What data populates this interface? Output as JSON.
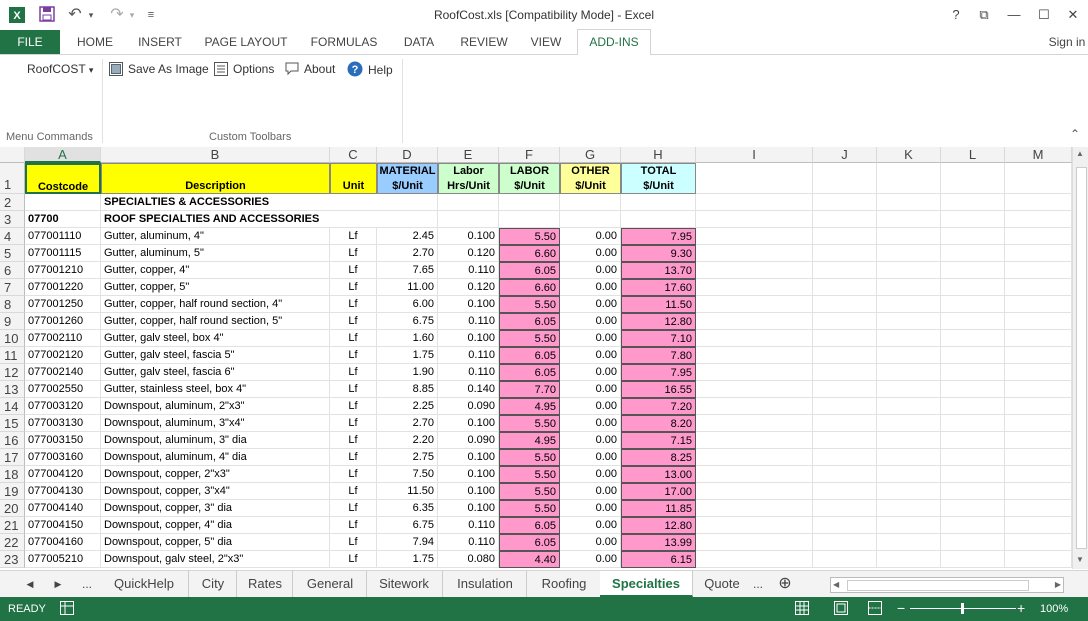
{
  "window": {
    "title": "RoofCost.xls  [Compatibility Mode] - Excel",
    "undo_glyph": "↶",
    "redo_glyph": "↷",
    "customize_glyph": "≡",
    "help_glyph": "?",
    "restore_glyph": "⧉",
    "minimize_glyph": "—",
    "maximize_glyph": "☐",
    "close_glyph": "✕",
    "signin": "Sign in"
  },
  "ribbon_tabs": [
    "FILE",
    "HOME",
    "INSERT",
    "PAGE LAYOUT",
    "FORMULAS",
    "DATA",
    "REVIEW",
    "VIEW",
    "ADD-INS"
  ],
  "active_ribbon_tab": "ADD-INS",
  "ribbon": {
    "menu_button": "RoofCOST",
    "menu_chevron": "▾",
    "group1_label": "Menu Commands",
    "group2_label": "Custom Toolbars",
    "save_as_image": "Save As Image",
    "options": "Options",
    "about": "About",
    "help": "Help",
    "collapse_glyph": "⌃"
  },
  "columns": [
    "A",
    "B",
    "C",
    "D",
    "E",
    "F",
    "G",
    "H",
    "I",
    "J",
    "K",
    "L",
    "M"
  ],
  "header_row": {
    "costcode": "Costcode",
    "description": "Description",
    "unit": "Unit",
    "material_1": "MATERIAL",
    "material_2": "$/Unit",
    "labor_1": "Labor",
    "labor_2": "Hrs/Unit",
    "labor_cost_1": "LABOR",
    "labor_cost_2": "$/Unit",
    "other_1": "OTHER",
    "other_2": "$/Unit",
    "total_1": "TOTAL",
    "total_2": "$/Unit"
  },
  "section_title": "SPECIALTIES & ACCESSORIES",
  "subsection": {
    "code": "07700",
    "title": "ROOF SPECIALTIES AND ACCESSORIES"
  },
  "rows": [
    {
      "n": "4",
      "code": "077001110",
      "desc": "Gutter, aluminum, 4\"",
      "unit": "Lf",
      "material": "2.45",
      "hrs": "0.100",
      "labor": "5.50",
      "other": "0.00",
      "total": "7.95"
    },
    {
      "n": "5",
      "code": "077001115",
      "desc": "Gutter, aluminum, 5\"",
      "unit": "Lf",
      "material": "2.70",
      "hrs": "0.120",
      "labor": "6.60",
      "other": "0.00",
      "total": "9.30"
    },
    {
      "n": "6",
      "code": "077001210",
      "desc": "Gutter, copper, 4\"",
      "unit": "Lf",
      "material": "7.65",
      "hrs": "0.110",
      "labor": "6.05",
      "other": "0.00",
      "total": "13.70"
    },
    {
      "n": "7",
      "code": "077001220",
      "desc": "Gutter, copper, 5\"",
      "unit": "Lf",
      "material": "11.00",
      "hrs": "0.120",
      "labor": "6.60",
      "other": "0.00",
      "total": "17.60"
    },
    {
      "n": "8",
      "code": "077001250",
      "desc": "Gutter, copper, half round section, 4\"",
      "unit": "Lf",
      "material": "6.00",
      "hrs": "0.100",
      "labor": "5.50",
      "other": "0.00",
      "total": "11.50"
    },
    {
      "n": "9",
      "code": "077001260",
      "desc": "Gutter, copper, half round section, 5\"",
      "unit": "Lf",
      "material": "6.75",
      "hrs": "0.110",
      "labor": "6.05",
      "other": "0.00",
      "total": "12.80"
    },
    {
      "n": "10",
      "code": "077002110",
      "desc": "Gutter, galv steel, box 4\"",
      "unit": "Lf",
      "material": "1.60",
      "hrs": "0.100",
      "labor": "5.50",
      "other": "0.00",
      "total": "7.10"
    },
    {
      "n": "11",
      "code": "077002120",
      "desc": "Gutter, galv steel, fascia 5\"",
      "unit": "Lf",
      "material": "1.75",
      "hrs": "0.110",
      "labor": "6.05",
      "other": "0.00",
      "total": "7.80"
    },
    {
      "n": "12",
      "code": "077002140",
      "desc": "Gutter, galv steel, fascia 6\"",
      "unit": "Lf",
      "material": "1.90",
      "hrs": "0.110",
      "labor": "6.05",
      "other": "0.00",
      "total": "7.95"
    },
    {
      "n": "13",
      "code": "077002550",
      "desc": "Gutter, stainless steel, box 4\"",
      "unit": "Lf",
      "material": "8.85",
      "hrs": "0.140",
      "labor": "7.70",
      "other": "0.00",
      "total": "16.55"
    },
    {
      "n": "14",
      "code": "077003120",
      "desc": "Downspout, aluminum, 2\"x3\"",
      "unit": "Lf",
      "material": "2.25",
      "hrs": "0.090",
      "labor": "4.95",
      "other": "0.00",
      "total": "7.20"
    },
    {
      "n": "15",
      "code": "077003130",
      "desc": "Downspout, aluminum, 3\"x4\"",
      "unit": "Lf",
      "material": "2.70",
      "hrs": "0.100",
      "labor": "5.50",
      "other": "0.00",
      "total": "8.20"
    },
    {
      "n": "16",
      "code": "077003150",
      "desc": "Downspout, aluminum, 3\" dia",
      "unit": "Lf",
      "material": "2.20",
      "hrs": "0.090",
      "labor": "4.95",
      "other": "0.00",
      "total": "7.15"
    },
    {
      "n": "17",
      "code": "077003160",
      "desc": "Downspout, aluminum, 4\" dia",
      "unit": "Lf",
      "material": "2.75",
      "hrs": "0.100",
      "labor": "5.50",
      "other": "0.00",
      "total": "8.25"
    },
    {
      "n": "18",
      "code": "077004120",
      "desc": "Downspout, copper, 2\"x3\"",
      "unit": "Lf",
      "material": "7.50",
      "hrs": "0.100",
      "labor": "5.50",
      "other": "0.00",
      "total": "13.00"
    },
    {
      "n": "19",
      "code": "077004130",
      "desc": "Downspout, copper, 3\"x4\"",
      "unit": "Lf",
      "material": "11.50",
      "hrs": "0.100",
      "labor": "5.50",
      "other": "0.00",
      "total": "17.00"
    },
    {
      "n": "20",
      "code": "077004140",
      "desc": "Downspout, copper, 3\" dia",
      "unit": "Lf",
      "material": "6.35",
      "hrs": "0.100",
      "labor": "5.50",
      "other": "0.00",
      "total": "11.85"
    },
    {
      "n": "21",
      "code": "077004150",
      "desc": "Downspout, copper, 4\" dia",
      "unit": "Lf",
      "material": "6.75",
      "hrs": "0.110",
      "labor": "6.05",
      "other": "0.00",
      "total": "12.80"
    },
    {
      "n": "22",
      "code": "077004160",
      "desc": "Downspout, copper, 5\" dia",
      "unit": "Lf",
      "material": "7.94",
      "hrs": "0.110",
      "labor": "6.05",
      "other": "0.00",
      "total": "13.99"
    },
    {
      "n": "23",
      "code": "077005210",
      "desc": "Downspout, galv steel, 2\"x3\"",
      "unit": "Lf",
      "material": "1.75",
      "hrs": "0.080",
      "labor": "4.40",
      "other": "0.00",
      "total": "6.15"
    }
  ],
  "sheet_nav": {
    "prev": "◀",
    "next": "▶",
    "more": "...",
    "more_right": "...",
    "add": "⊕"
  },
  "sheets": [
    "QuickHelp",
    "City",
    "Rates",
    "General",
    "Sitework",
    "Insulation",
    "Roofing",
    "Specialties",
    "Quote"
  ],
  "active_sheet": "Specialties",
  "status": {
    "ready": "READY",
    "zoom": "100%",
    "minus": "−",
    "plus": "+"
  },
  "colors": {
    "excel_green": "#217346",
    "yellow_header": "#ffff00",
    "material_header": "#99ccff",
    "labor_header": "#ccffcc",
    "labor_cost_header": "#ccffcc",
    "other_header": "#ffff99",
    "total_header": "#ccffff",
    "pink_cells": "#ff99cc"
  }
}
